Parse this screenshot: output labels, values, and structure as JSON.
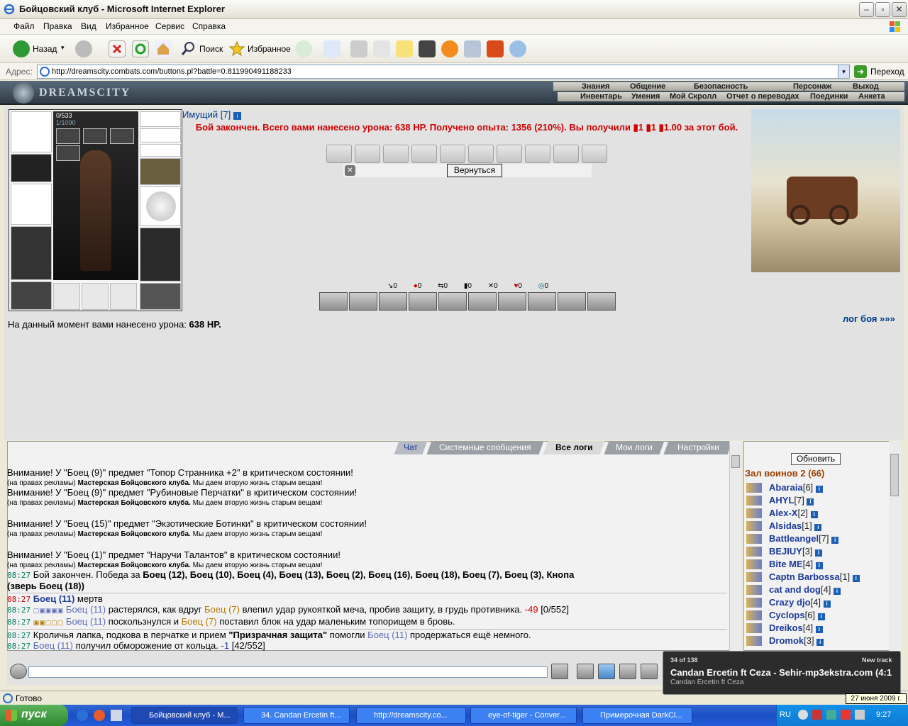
{
  "window": {
    "title": "Бойцовский клуб - Microsoft Internet Explorer"
  },
  "menu": [
    "Файл",
    "Правка",
    "Вид",
    "Избранное",
    "Сервис",
    "Справка"
  ],
  "toolbar": {
    "back": "Назад",
    "search": "Поиск",
    "favorites": "Избранное"
  },
  "address": {
    "label": "Адрес:",
    "url": "http://dreamscity.combats.com/buttons.pl?battle=0.811990491188233",
    "go": "Переход"
  },
  "game": {
    "logo": "DREAMSCITY",
    "nav_top": [
      "Знания",
      "Общение",
      "Безопасность",
      "Персонаж",
      "Выход"
    ],
    "nav_bottom": [
      "Инвентарь",
      "Умения",
      "Мой Скролл",
      "Отчет о переводах",
      "Поединки",
      "Анкета"
    ],
    "hp": "0/533",
    "mana": "1/1090",
    "username": "Имущий [7]",
    "info_icon": "i",
    "battle_message": "Бой закончен. Всего вами нанесено урона: 638 HP. Получено опыта: 1356 (210%). Вы получили ▮1 ▮1 ▮1.00 за этот бой.",
    "back_button": "Вернуться",
    "stats": [
      "0",
      "0",
      "0",
      "0",
      "0",
      "0",
      "0"
    ],
    "battle_log_link": "лог боя »»»",
    "damage_label": "На данный момент вами нанесено урона:",
    "damage_value": "638 HP."
  },
  "chat": {
    "tabs": [
      "Чат",
      "Системные сообщения",
      "Все логи",
      "Мои логи",
      "Настройки"
    ],
    "active_tab": "Все логи",
    "ad_prefix": "(на правах рекламы)",
    "ad_workshop": "Мастерская Бойцовского клуба.",
    "ad_suffix": "Мы даем вторую жизнь старым вещам!",
    "warn1": "Внимание! У \"Боец (9)\" предмет \"Топор Странника +2\" в критическом состоянии!",
    "warn2": "Внимание! У \"Боец (9)\" предмет \"Рубиновые Перчатки\" в критическом состоянии!",
    "warn3": "Внимание! У \"Боец (15)\" предмет \"Экзотические Ботинки\" в критическом состоянии!",
    "warn4": "Внимание! У \"Боец (1)\" предмет \"Наручи Талантов\" в критическом состоянии!",
    "t1": "08:27",
    "l1_text": "Бой закончен. Победа за",
    "l1_winners": "Боец (12), Боец (10), Боец (4), Боец (13), Боец (2), Боец (16), Боец (18), Боец (7), Боец (3), Кнопа",
    "l1_winners2": "(зверь Боец (18))",
    "l2_name": "Боец (11)",
    "l2_text": "мертв",
    "l3_name": "Боец (11)",
    "l3_a": "растерялся, как вдруг",
    "l3_name2": "Боец (7)",
    "l3_b": "влепил удар рукояткой меча, пробив защиту, в грудь противника.",
    "l3_dmg": "-49",
    "l3_hp": "[0/552]",
    "l4_name": "Боец (11)",
    "l4_a": "поскользнулся и",
    "l4_name2": "Боец (7)",
    "l4_b": "поставил блок на удар маленьким топорищем в бровь.",
    "l5_a": "Кроличья лапка, подкова в перчатке и прием",
    "l5_q": "\"Призрачная защита\"",
    "l5_b": "помогли",
    "l5_name": "Боец (11)",
    "l5_c": "продержаться ещё немного.",
    "l6_name": "Боец (11)",
    "l6_a": "получил обморожение от кольца.",
    "l6_dmg": "-1",
    "l6_hp": "[42/552]"
  },
  "players": {
    "refresh": "Обновить",
    "hall": "Зал воинов 2 (66)",
    "list": [
      {
        "name": "Abaraia",
        "level": "[6]"
      },
      {
        "name": "AHYL",
        "level": "[7]"
      },
      {
        "name": "Alex-X",
        "level": "[2]"
      },
      {
        "name": "Alsidas",
        "level": "[1]"
      },
      {
        "name": "Battleangel",
        "level": "[7]"
      },
      {
        "name": "BEJIUY",
        "level": "[3]"
      },
      {
        "name": "Bite ME",
        "level": "[4]"
      },
      {
        "name": "Captn Barbossa",
        "level": "[1]"
      },
      {
        "name": "cat and dog",
        "level": "[4]"
      },
      {
        "name": "Crazy djo",
        "level": "[4]"
      },
      {
        "name": "Cyclops",
        "level": "[6]"
      },
      {
        "name": "Dreikos",
        "level": "[4]"
      },
      {
        "name": "Dromok",
        "level": "[3]"
      }
    ]
  },
  "popup": {
    "count": "34 of 138",
    "label": "New track",
    "track": "Candan Ercetin ft Ceza - Sehir-mp3ekstra.com (4:1",
    "artist": "Candan Ercetin ft Ceza",
    "date_tip": "27 июня 2009 г."
  },
  "status": "Готово",
  "taskbar": {
    "start": "пуск",
    "tasks": [
      "Бойцовский клуб - M...",
      "34. Candan Ercetin ft...",
      "http://dreamscity.co...",
      "eye-of-tiger - Conver...",
      "Примерочная DarkCl..."
    ],
    "lang": "RU",
    "clock": "9:27"
  }
}
